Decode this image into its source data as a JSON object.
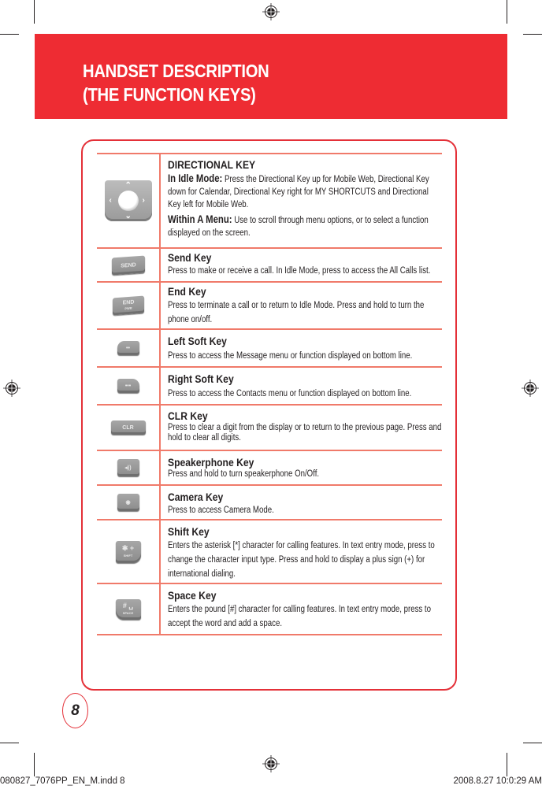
{
  "header": {
    "title_line1": "HANDSET DESCRIPTION",
    "title_line2": "(THE FUNCTION KEYS)"
  },
  "colors": {
    "banner": "#ee2c33",
    "card_border": "#e43038",
    "row_rule": "#f07a6a",
    "text": "#231f20"
  },
  "keys": [
    {
      "icon": "directional-key-icon",
      "title": "DIRECTIONAL KEY",
      "paragraphs": [
        {
          "label": "In Idle Mode:",
          "text": " Press the Directional Key up for Mobile Web, Directional Key down for Calendar, Directional Key right for MY SHORTCUTS and Directional Key left for Mobile Web."
        },
        {
          "label": "Within A Menu:",
          "text": " Use to scroll through menu options, or to select a function displayed on the screen."
        }
      ]
    },
    {
      "icon": "send-key-icon",
      "icon_label": "SEND",
      "title": "Send Key",
      "text": "Press to make or receive a call. In Idle Mode, press to access the All Calls list."
    },
    {
      "icon": "end-key-icon",
      "icon_label": "END",
      "icon_sublabel": "PWR",
      "title": "End Key",
      "text": "Press to terminate a call or to return to Idle Mode. Press and hold to turn the phone on/off."
    },
    {
      "icon": "left-soft-key-icon",
      "icon_label": "••",
      "title": "Left Soft Key",
      "text": "Press to access the Message menu or function displayed on bottom line."
    },
    {
      "icon": "right-soft-key-icon",
      "icon_label": "•••",
      "title": "Right Soft Key",
      "text": "Press to access the Contacts menu or function displayed on bottom line."
    },
    {
      "icon": "clr-key-icon",
      "icon_label": "CLR",
      "title": "CLR Key",
      "text": "Press to clear a digit from the display or to return to the previous page. Press and hold to clear all digits."
    },
    {
      "icon": "speakerphone-key-icon",
      "icon_label": "◂))",
      "title": "Speakerphone Key",
      "text": "Press and hold to turn speakerphone On/Off."
    },
    {
      "icon": "camera-key-icon",
      "icon_label": "◉",
      "title": "Camera Key",
      "text": "Press to access Camera Mode."
    },
    {
      "icon": "shift-key-icon",
      "icon_label": "✱ +",
      "icon_sublabel": "SHIFT",
      "title": "Shift Key",
      "text": "Enters the asterisk [*] character for calling features. In text entry mode, press to change the character input type. Press and hold to display a plus sign (+) for international dialing."
    },
    {
      "icon": "space-key-icon",
      "icon_label": "# ␣",
      "icon_sublabel": "SPACE",
      "title": "Space Key",
      "text": "Enters the pound [#] character for calling features. In text entry mode, press to accept the word and add a space."
    }
  ],
  "footer": {
    "page_number": "8",
    "slug_file": "080827_7076PP_EN_M.indd   8",
    "slug_date": "2008.8.27   10:0:29 AM"
  }
}
